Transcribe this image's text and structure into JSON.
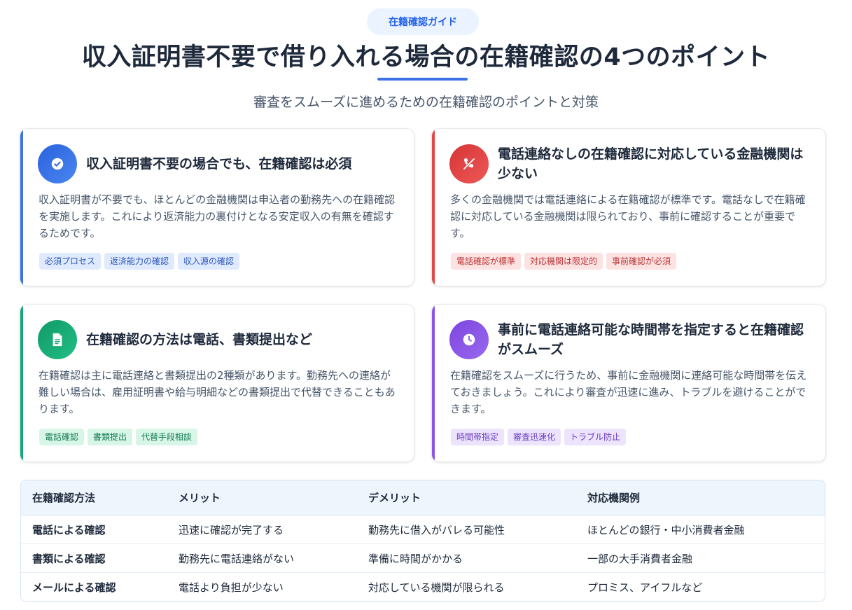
{
  "header": {
    "badge": "在籍確認ガイド",
    "title": "収入証明書不要で借り入れる場合の在籍確認の4つのポイント",
    "subtitle": "審査をスムーズに進めるための在籍確認のポイントと対策"
  },
  "colors": {
    "blue": "#3b72e6",
    "red": "#e24848",
    "green": "#16a974",
    "purple": "#8a55e6"
  },
  "cards": [
    {
      "icon": "check-circle-icon",
      "title": "収入証明書不要の場合でも、在籍確認は必須",
      "description": "収入証明書が不要でも、ほとんどの金融機関は申込者の勤務先への在籍確認を実施します。これにより返済能力の裏付けとなる安定収入の有無を確認するためです。",
      "tags": [
        "必須プロセス",
        "返済能力の確認",
        "収入源の確認"
      ]
    },
    {
      "icon": "phone-off-icon",
      "title": "電話連絡なしの在籍確認に対応している金融機関は少ない",
      "description": "多くの金融機関では電話連絡による在籍確認が標準です。電話なしで在籍確認に対応している金融機関は限られており、事前に確認することが重要です。",
      "tags": [
        "電話確認が標準",
        "対応機関は限定的",
        "事前確認が必須"
      ]
    },
    {
      "icon": "document-icon",
      "title": "在籍確認の方法は電話、書類提出など",
      "description": "在籍確認は主に電話連絡と書類提出の2種類があります。勤務先への連絡が難しい場合は、雇用証明書や給与明細などの書類提出で代替できることもあります。",
      "tags": [
        "電話確認",
        "書類提出",
        "代替手段相談"
      ]
    },
    {
      "icon": "clock-icon",
      "title": "事前に電話連絡可能な時間帯を指定すると在籍確認がスムーズ",
      "description": "在籍確認をスムーズに行うため、事前に金融機関に連絡可能な時間帯を伝えておきましょう。これにより審査が迅速に進み、トラブルを避けることができます。",
      "tags": [
        "時間帯指定",
        "審査迅速化",
        "トラブル防止"
      ]
    }
  ],
  "table": {
    "headers": [
      "在籍確認方法",
      "メリット",
      "デメリット",
      "対応機関例"
    ],
    "rows": [
      [
        "電話による確認",
        "迅速に確認が完了する",
        "勤務先に借入がバレる可能性",
        "ほとんどの銀行・中小消費者金融"
      ],
      [
        "書類による確認",
        "勤務先に電話連絡がない",
        "準備に時間がかかる",
        "一部の大手消費者金融"
      ],
      [
        "メールによる確認",
        "電話より負担が少ない",
        "対応している機関が限られる",
        "プロミス、アイフルなど"
      ]
    ]
  }
}
